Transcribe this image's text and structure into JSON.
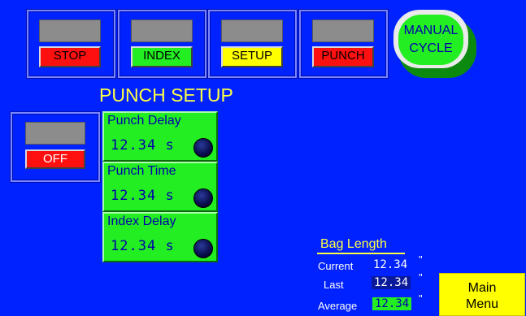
{
  "buttons": {
    "stop": "STOP",
    "index": "INDEX",
    "setup": "SETUP",
    "punch": "PUNCH",
    "off": "OFF"
  },
  "manual_cycle": {
    "line1": "MANUAL",
    "line2": "CYCLE"
  },
  "section_title": "PUNCH SETUP",
  "params": [
    {
      "label": "Punch Delay",
      "value": "12.34",
      "unit": "s"
    },
    {
      "label": "Punch Time",
      "value": "12.34",
      "unit": "s"
    },
    {
      "label": "Index Delay",
      "value": "12.34",
      "unit": "s"
    }
  ],
  "bag_length": {
    "title": "Bag Length",
    "current_label": "Current",
    "current_value": "12.34",
    "last_label": "Last",
    "last_value": "12.34",
    "average_label": "Average",
    "average_value": "12.34",
    "unit": "\""
  },
  "main_menu": {
    "line1": "Main",
    "line2": "Menu"
  },
  "colors": {
    "background": "#0022ff",
    "title": "#ffff44",
    "green": "#22ee22",
    "red": "#ff1010",
    "yellow": "#ffff00"
  }
}
